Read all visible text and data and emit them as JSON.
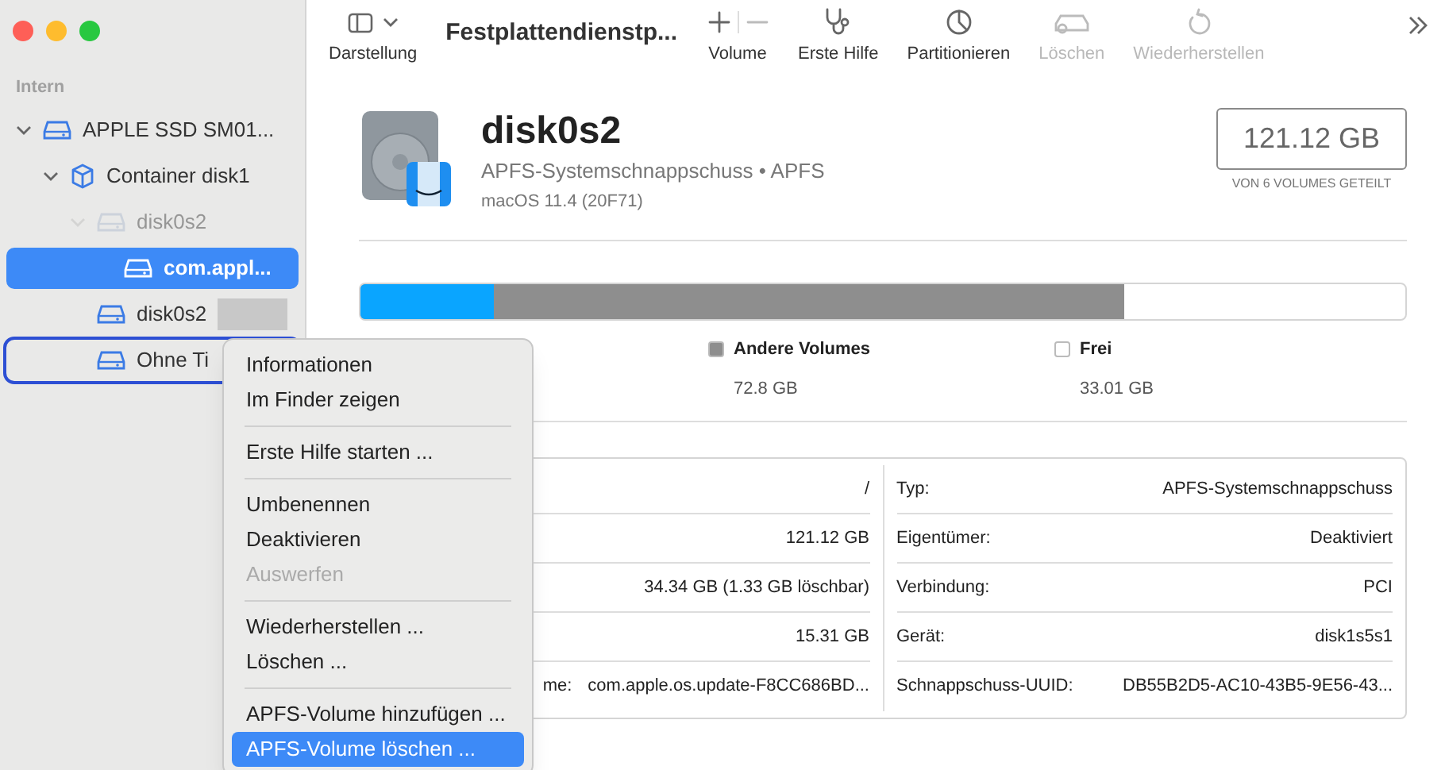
{
  "sidebar": {
    "section": "Intern",
    "items": [
      {
        "label": "APPLE SSD SM01...",
        "kind": "drive",
        "expanded": true,
        "selected": false,
        "dimmed": false,
        "outlined": false,
        "children": [
          {
            "label": "Container disk1",
            "kind": "container",
            "expanded": true,
            "selected": false,
            "dimmed": false,
            "outlined": false,
            "children": [
              {
                "label": "disk0s2",
                "kind": "drive",
                "expanded": true,
                "selected": false,
                "dimmed": true,
                "outlined": false,
                "children": [
                  {
                    "label": "com.appl...",
                    "kind": "drive",
                    "selected": true,
                    "dimmed": false,
                    "outlined": false,
                    "redacted": false
                  }
                ]
              },
              {
                "label": "disk0s2",
                "kind": "drive",
                "selected": false,
                "dimmed": false,
                "outlined": false,
                "redacted": true
              },
              {
                "label": "Ohne Ti",
                "kind": "drive",
                "selected": false,
                "dimmed": false,
                "outlined": true,
                "redacted": false
              }
            ]
          }
        ]
      }
    ]
  },
  "toolbar": {
    "view_label": "Darstellung",
    "title": "Festplattendienstp...",
    "buttons": [
      {
        "label": "Volume",
        "kind": "plusminus",
        "disabled": false
      },
      {
        "label": "Erste Hilfe",
        "kind": "stethoscope",
        "disabled": false
      },
      {
        "label": "Partitionieren",
        "kind": "pie",
        "disabled": false
      },
      {
        "label": "Löschen",
        "kind": "erase",
        "disabled": true
      },
      {
        "label": "Wiederherstellen",
        "kind": "restore",
        "disabled": true
      }
    ]
  },
  "volume": {
    "name": "disk0s2",
    "subtitle": "APFS-Systemschnappschuss • APFS",
    "os": "macOS 11.4 (20F71)",
    "size": "121.12 GB",
    "size_note": "VON 6 VOLUMES GETEILT"
  },
  "usage": {
    "segments": [
      {
        "color": "#0aa5ff",
        "level": 0.127
      },
      {
        "color": "#8e8e8e",
        "level": 0.731
      }
    ],
    "legend": [
      {
        "label": "Andere Volumes",
        "value": "72.8 GB",
        "color": "#8e8e8e"
      },
      {
        "label": "Frei",
        "value": "33.01 GB",
        "color": "#ffffff"
      }
    ]
  },
  "details": {
    "left": [
      {
        "value": "/"
      },
      {
        "value": "121.12 GB"
      },
      {
        "value": "34.34 GB (1.33 GB löschbar)"
      },
      {
        "value": "15.31 GB"
      },
      {
        "label": "me:",
        "value": "com.apple.os.update-F8CC686BD..."
      }
    ],
    "right": [
      {
        "label": "Typ:",
        "value": "APFS-Systemschnappschuss"
      },
      {
        "label": "Eigentümer:",
        "value": "Deaktiviert"
      },
      {
        "label": "Verbindung:",
        "value": "PCI"
      },
      {
        "label": "Gerät:",
        "value": "disk1s5s1"
      },
      {
        "label": "Schnappschuss-UUID:",
        "value": "DB55B2D5-AC10-43B5-9E56-43..."
      }
    ]
  },
  "context_menu": {
    "groups": [
      [
        {
          "label": "Informationen",
          "disabled": false,
          "selected": false
        },
        {
          "label": "Im Finder zeigen",
          "disabled": false,
          "selected": false
        }
      ],
      [
        {
          "label": "Erste Hilfe starten ...",
          "disabled": false,
          "selected": false
        }
      ],
      [
        {
          "label": "Umbenennen",
          "disabled": false,
          "selected": false
        },
        {
          "label": "Deaktivieren",
          "disabled": false,
          "selected": false
        },
        {
          "label": "Auswerfen",
          "disabled": true,
          "selected": false
        }
      ],
      [
        {
          "label": "Wiederherstellen ...",
          "disabled": false,
          "selected": false
        },
        {
          "label": "Löschen ...",
          "disabled": false,
          "selected": false
        }
      ],
      [
        {
          "label": "APFS-Volume hinzufügen ...",
          "disabled": false,
          "selected": false
        },
        {
          "label": "APFS-Volume löschen ...",
          "disabled": false,
          "selected": true
        }
      ]
    ]
  }
}
